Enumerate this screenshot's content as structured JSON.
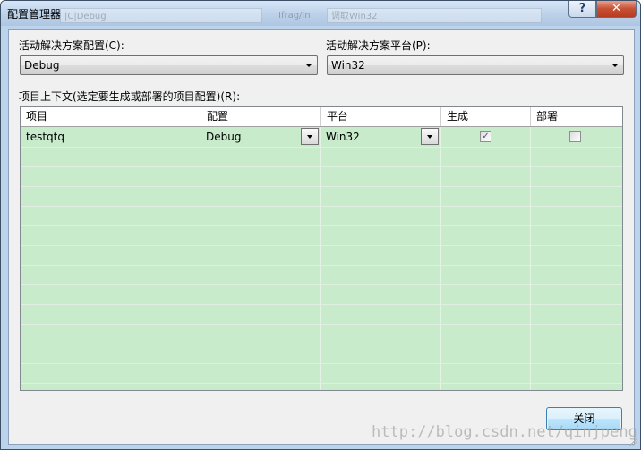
{
  "window": {
    "title": "配置管理器",
    "background_ghost": [
      "|C|Debug",
      "Ifrag/in",
      "调取Win32"
    ],
    "help_label": "?",
    "close_label": "✕"
  },
  "solution": {
    "config_label": "活动解决方案配置(C):",
    "config_value": "Debug",
    "platform_label": "活动解决方案平台(P):",
    "platform_value": "Win32"
  },
  "grid": {
    "label": "项目上下文(选定要生成或部署的项目配置)(R):",
    "columns": [
      "项目",
      "配置",
      "平台",
      "生成",
      "部署"
    ],
    "rows": [
      {
        "project": "testqtq",
        "configuration": "Debug",
        "platform": "Win32",
        "build": true,
        "deploy": false
      }
    ],
    "row_bg": "#c7ebcb"
  },
  "buttons": {
    "close": "关闭"
  },
  "watermark": "http://blog.csdn.net/qinjpeng"
}
